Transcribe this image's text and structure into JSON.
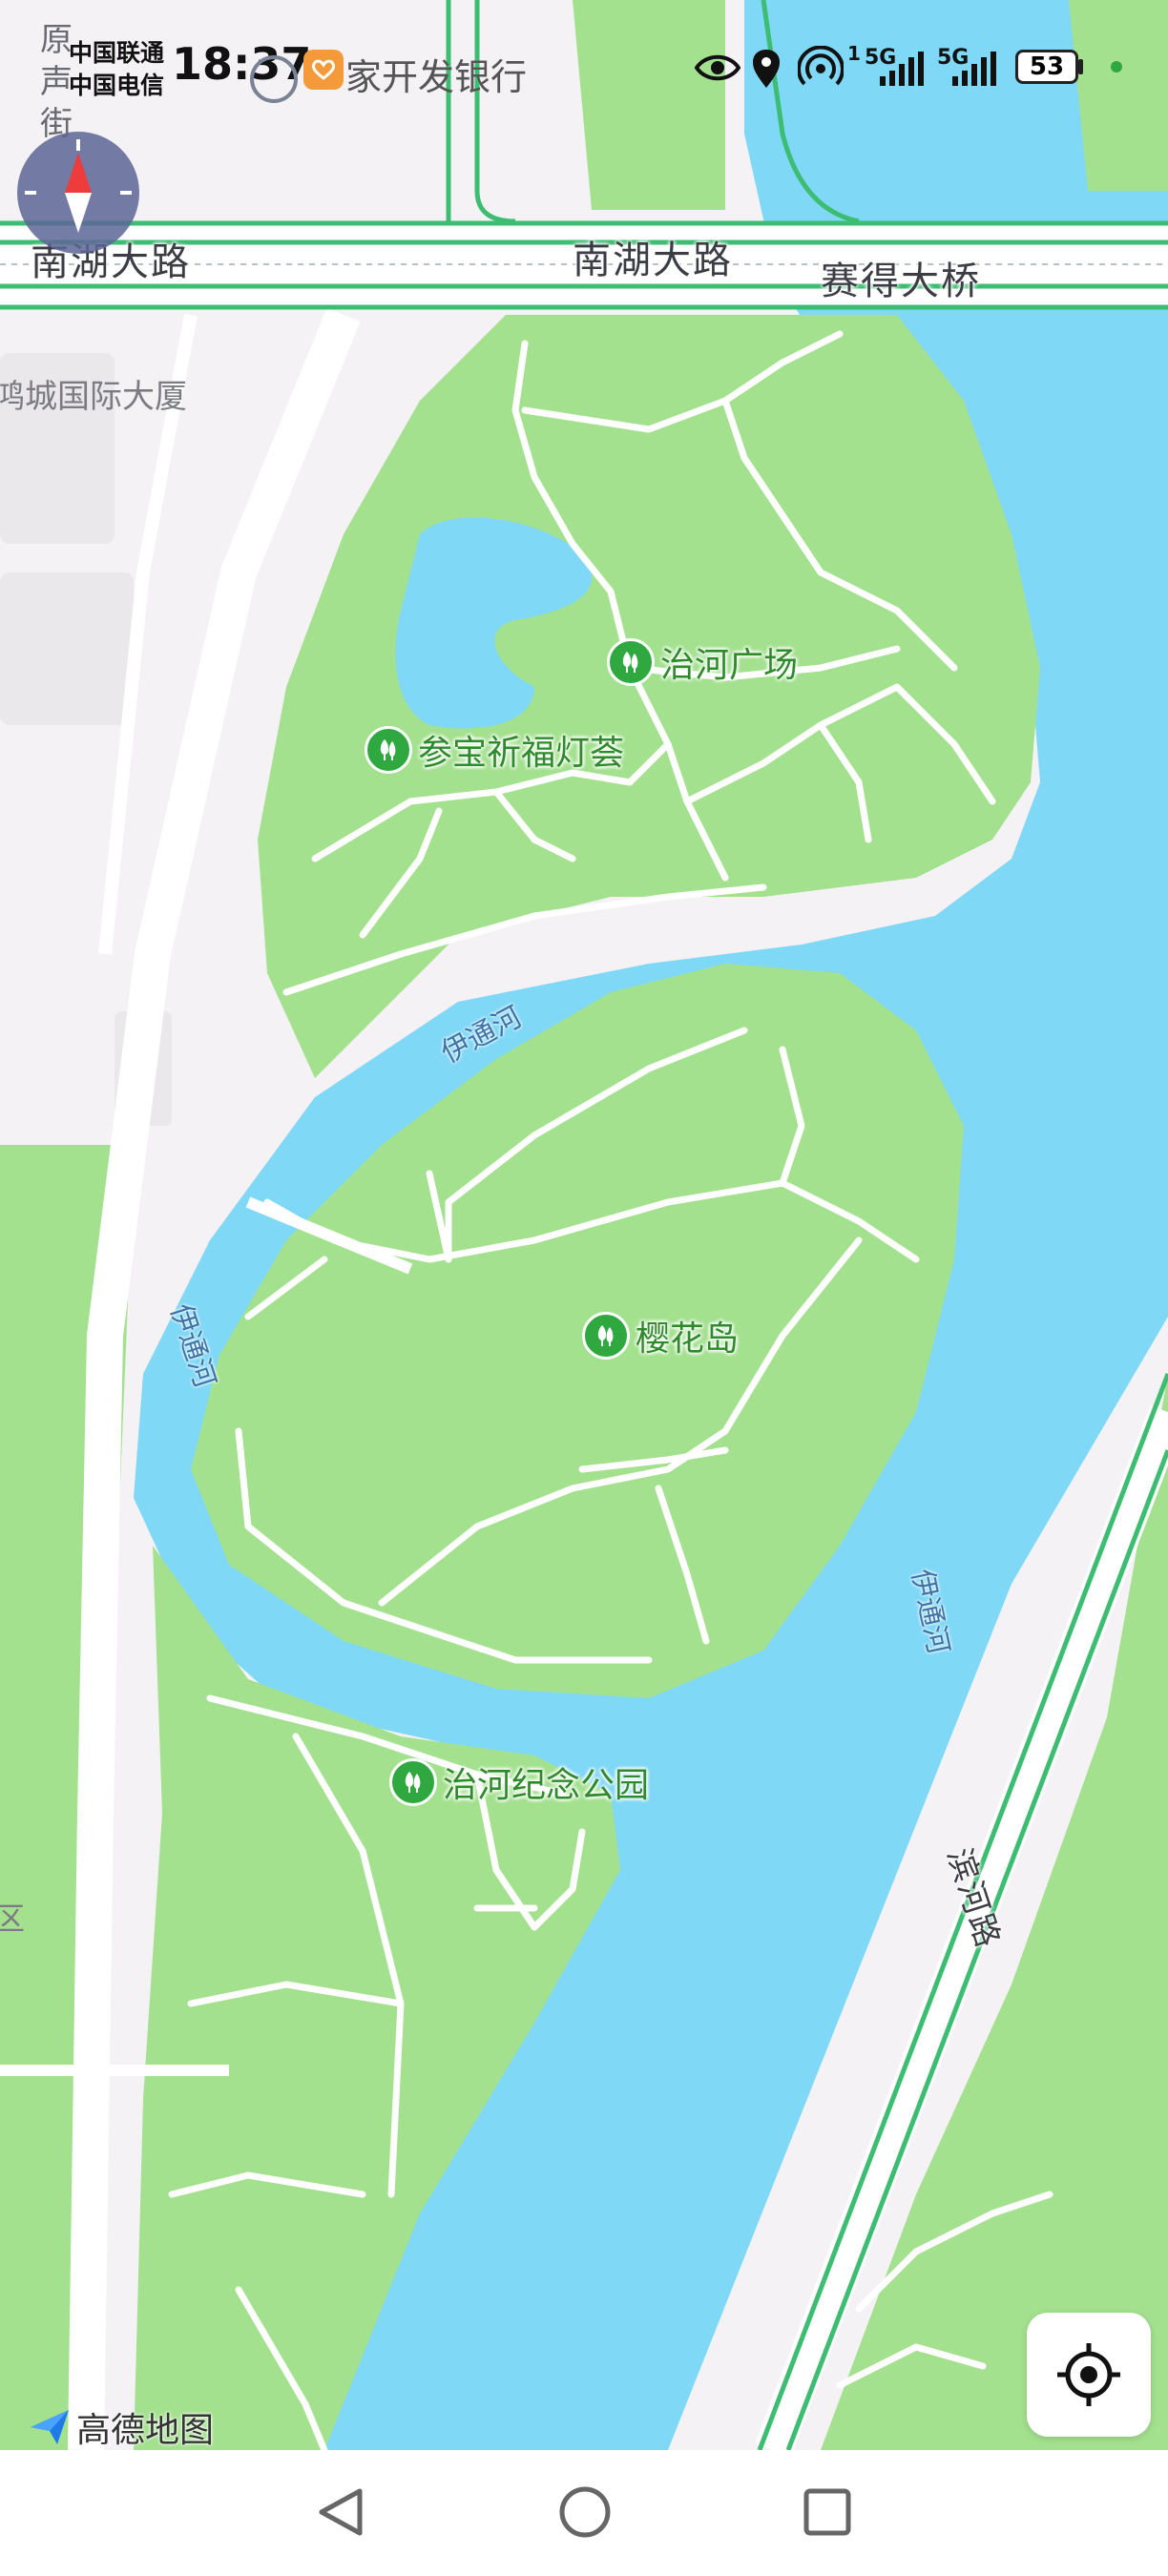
{
  "status_bar": {
    "carrier_1": "中国联通",
    "carrier_2": "中国电信",
    "time": "18:37",
    "app_text": "家开发银行",
    "battery": "53",
    "net_1": "5G",
    "net_2": "5G",
    "sim_num": "1"
  },
  "map": {
    "roads": {
      "south_lake_left": "南湖大路",
      "south_lake_center": "南湖大路",
      "saide_bridge": "赛得大桥",
      "binhe_road": "滨河路"
    },
    "places": {
      "partial_street": "原声街",
      "hecheng_building": "鸿城国际大厦",
      "partial_district": "区"
    },
    "water": {
      "yitong_1": "伊通河",
      "yitong_2": "伊通河",
      "yitong_3": "伊通河"
    },
    "pois": [
      {
        "name": "治河广场",
        "icon": "park-icon"
      },
      {
        "name": "参宝祈福灯荟",
        "icon": "park-icon"
      },
      {
        "name": "樱花岛",
        "icon": "park-icon"
      },
      {
        "name": "治河纪念公园",
        "icon": "park-icon"
      }
    ],
    "colors": {
      "water": "#7fd8f6",
      "park": "#a4e18f",
      "road": "#ffffff",
      "road_outline": "#3dbd72"
    }
  },
  "branding": {
    "logo_text": "高德地图"
  },
  "nav": {
    "back_icon": "back-triangle-icon",
    "home_icon": "home-circle-icon",
    "recents_icon": "recents-square-icon"
  }
}
